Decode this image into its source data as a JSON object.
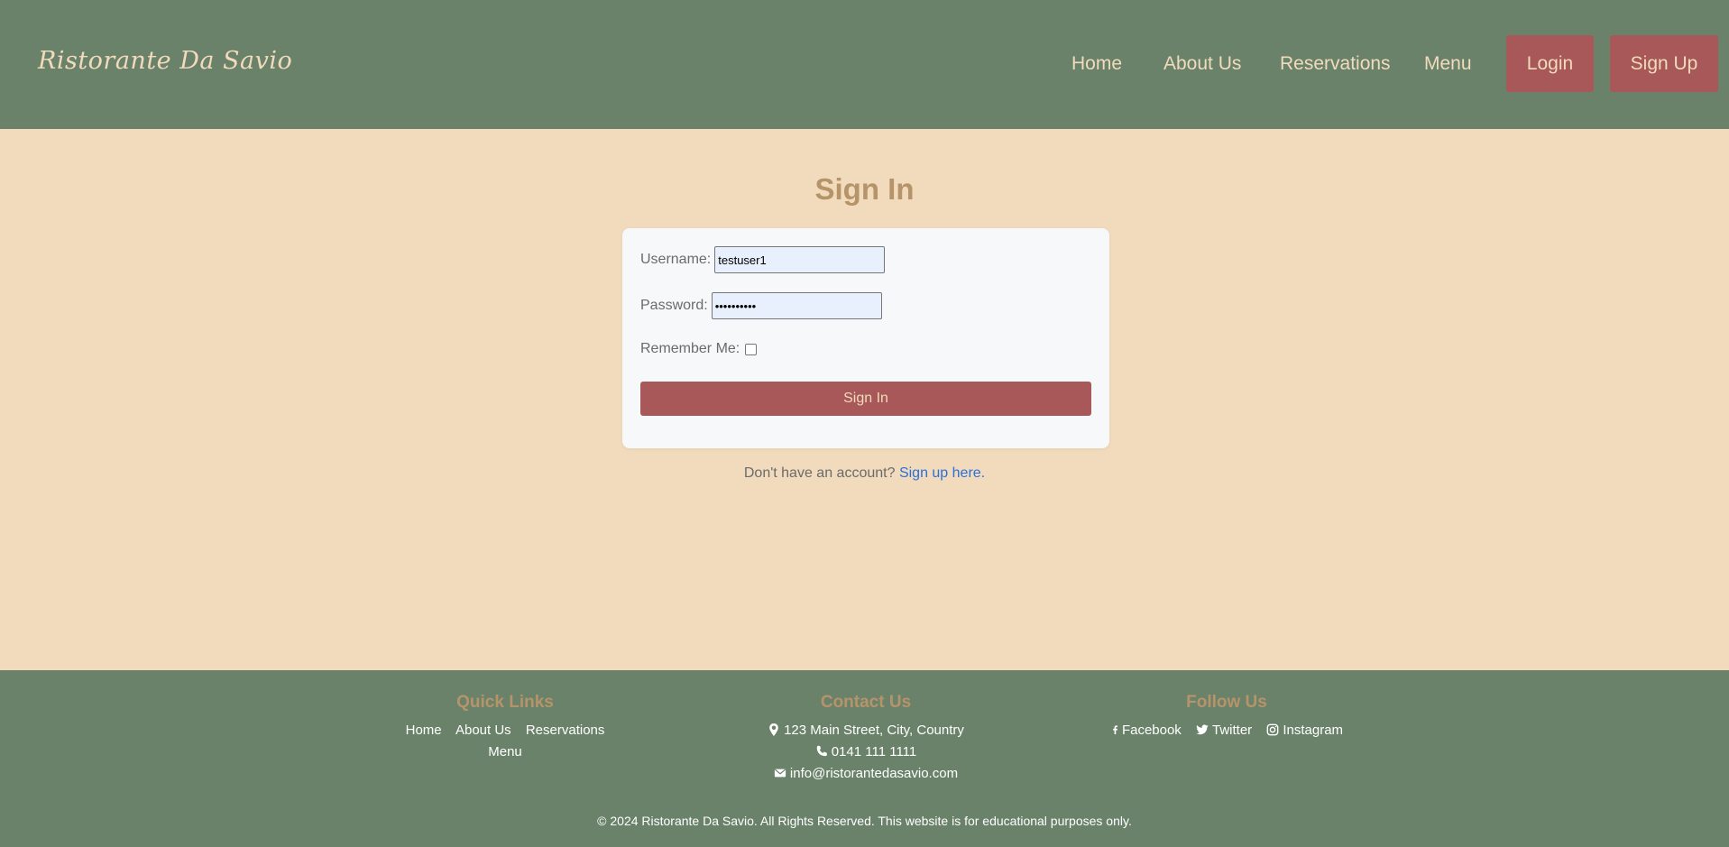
{
  "navbar": {
    "brand": "Ristorante Da Savio",
    "links": [
      "Home",
      "About Us",
      "Reservations",
      "Menu"
    ],
    "login_label": "Login",
    "signup_label": "Sign Up"
  },
  "main": {
    "title": "Sign In",
    "form": {
      "username_label": "Username:",
      "username_value": "testuser1",
      "password_label": "Password:",
      "password_value": "••••••••••",
      "remember_label": "Remember Me:",
      "remember_checked": false,
      "submit_label": "Sign In"
    },
    "signup_prompt": "Don't have an account?",
    "signup_link": "Sign up here."
  },
  "footer": {
    "quick_links": {
      "heading": "Quick Links",
      "links": [
        "Home",
        "About Us",
        "Reservations",
        "Menu"
      ]
    },
    "contact": {
      "heading": "Contact Us",
      "address": "123 Main Street, City, Country",
      "phone": "0141 111 1111",
      "email": "info@ristorantedasavio.com"
    },
    "follow": {
      "heading": "Follow Us",
      "links": [
        "Facebook",
        "Twitter",
        "Instagram"
      ]
    },
    "copyright": "© 2024 Ristorante Da Savio. All Rights Reserved. This website is for educational purposes only."
  },
  "colors": {
    "nav_bg": "#6a826a",
    "page_bg": "#f1dbbc",
    "accent_red": "#a85858",
    "heading_tan": "#b6946a",
    "link_blue": "#2a6fdb"
  },
  "icons": [
    "map-marker-icon",
    "phone-icon",
    "envelope-icon",
    "facebook-icon",
    "twitter-icon",
    "instagram-icon"
  ]
}
